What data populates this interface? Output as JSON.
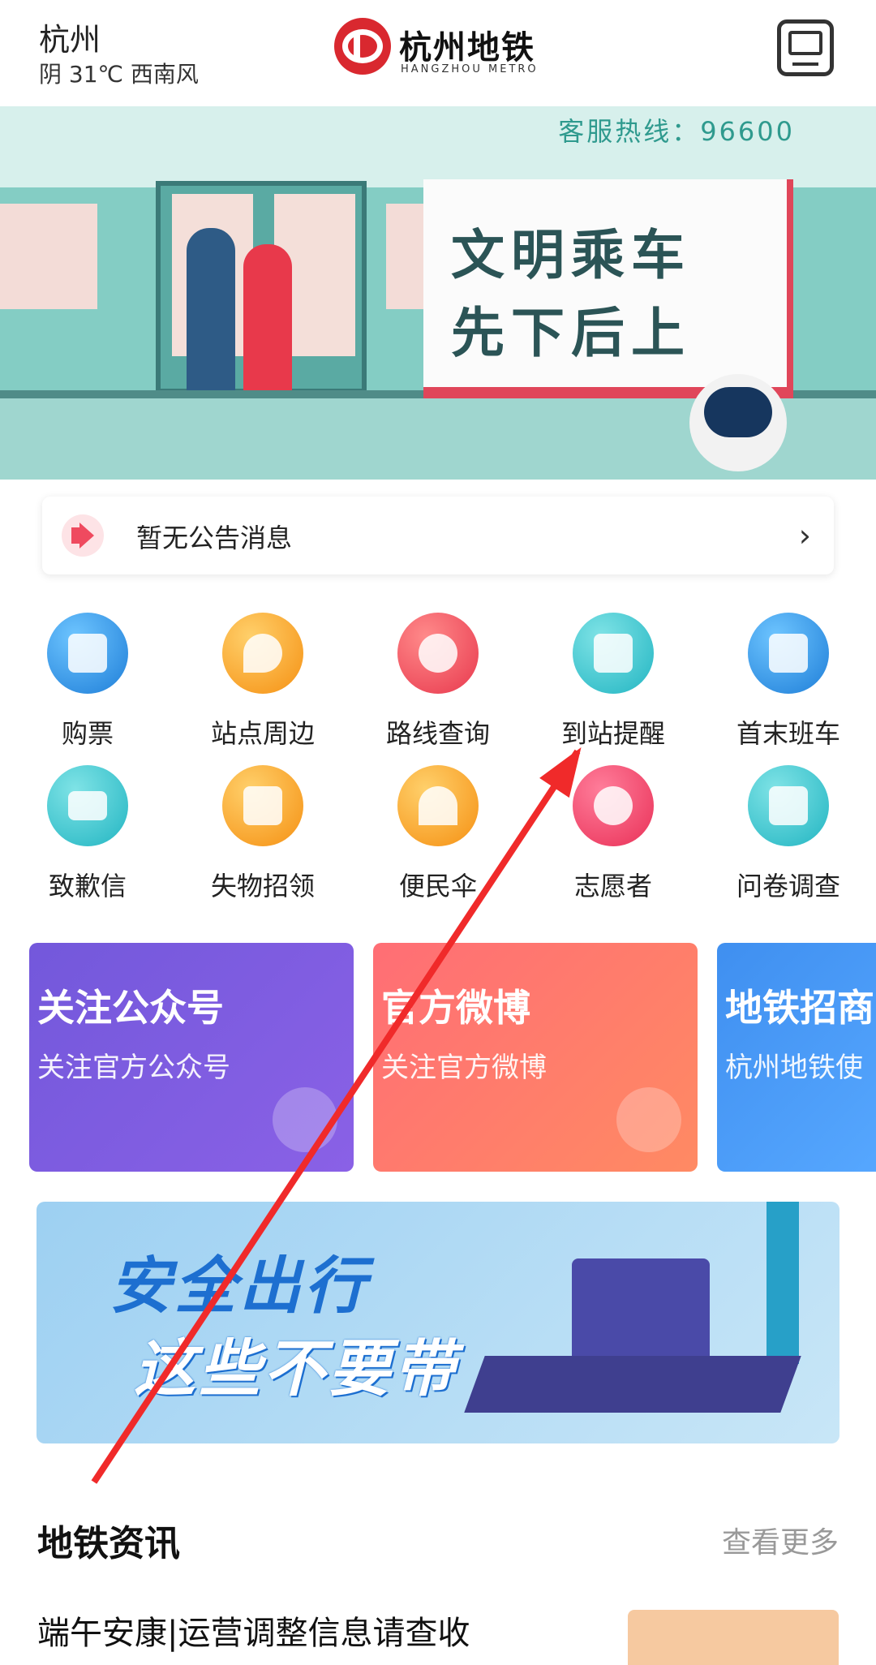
{
  "header": {
    "city": "杭州",
    "weather": "阴 31℃ 西南风",
    "logo_cn": "杭州地铁",
    "logo_en": "HANGZHOU METRO",
    "message_icon": "message-box-icon"
  },
  "banner": {
    "hotline": "客服热线：96600",
    "slogan_line1": "文明乘车",
    "slogan_line2": "先下后上"
  },
  "notice": {
    "icon": "speaker-icon",
    "text": "暂无公告消息",
    "chevron": "›"
  },
  "grid": {
    "items": [
      {
        "label": "购票",
        "icon": "ticket-train-icon",
        "color": "#1e7ed8"
      },
      {
        "label": "站点周边",
        "icon": "location-pin-icon",
        "color": "#f59012"
      },
      {
        "label": "路线查询",
        "icon": "clock-icon",
        "color": "#e8384d"
      },
      {
        "label": "到站提醒",
        "icon": "reminder-doc-icon",
        "color": "#22b5c2"
      },
      {
        "label": "首末班车",
        "icon": "train-icon",
        "color": "#1e7ed8"
      },
      {
        "label": "致歉信",
        "icon": "envelope-icon",
        "color": "#22b5c2"
      },
      {
        "label": "失物招领",
        "icon": "box-icon",
        "color": "#f59012"
      },
      {
        "label": "便民伞",
        "icon": "umbrella-icon",
        "color": "#f59012"
      },
      {
        "label": "志愿者",
        "icon": "heart-icon",
        "color": "#e93057"
      },
      {
        "label": "问卷调查",
        "icon": "survey-doc-icon",
        "color": "#22b5c2"
      }
    ]
  },
  "cards": [
    {
      "title": "关注公众号",
      "subtitle": "关注官方公众号",
      "icon": "verified-badge-icon"
    },
    {
      "title": "官方微博",
      "subtitle": "关注官方微博",
      "icon": "weibo-icon"
    },
    {
      "title": "地铁招商",
      "subtitle": "杭州地铁使",
      "icon": ""
    }
  ],
  "safety_banner": {
    "line1": "安全出行",
    "line2": "这些不要带"
  },
  "news": {
    "title": "地铁资讯",
    "more": "查看更多",
    "items": [
      {
        "title": "端午安康|运营调整信息请查收"
      }
    ]
  }
}
